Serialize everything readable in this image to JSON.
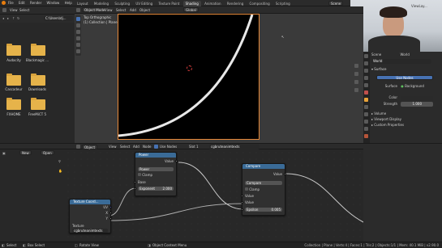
{
  "top_menu": [
    "File",
    "Edit",
    "Render",
    "Window",
    "Help"
  ],
  "workspace_tabs": [
    "Layout",
    "Modeling",
    "Sculpting",
    "UV Editing",
    "Texture Paint",
    "Shading",
    "Animation",
    "Rendering",
    "Compositing",
    "Scripting"
  ],
  "active_tab_index": 5,
  "scene": {
    "label": "Scene",
    "view_layer": "ViewLay..."
  },
  "file_browser": {
    "header_menu": [
      "View",
      "Select"
    ],
    "path": "C:\\Users\\dj...",
    "folders": [
      "Audacity",
      "Blackmagic ...",
      "Cascadeur",
      "Downloads",
      "FXHOME",
      "FreeMiCT 5"
    ]
  },
  "viewport": {
    "mode": "Object Mode",
    "menu": [
      "View",
      "Select",
      "Add",
      "Object"
    ],
    "shading": "Global",
    "view_name": "Top Orthographic",
    "collection": "(1) Collection | Plane"
  },
  "node_editor": {
    "object_mode": "Object",
    "menu": [
      "View",
      "Select",
      "Add",
      "Node"
    ],
    "use_nodes_label": "Use Nodes",
    "slot": "Slot 1",
    "material": "cgbruteanimtexts",
    "sidebar": {
      "new_label": "New",
      "open_label": "Open"
    }
  },
  "nodes": {
    "texcoord": {
      "title": "Texture Coord...",
      "outputs": [
        "UV",
        "X",
        "Y"
      ],
      "image_label": "Texture",
      "image_value": "cgbruteanimtexts"
    },
    "power": {
      "title": "Power",
      "output": "Value",
      "operation": "Power",
      "clamp": "Clamp",
      "base": "Base",
      "exponent_label": "Exponent",
      "exponent_value": "2.000"
    },
    "compare": {
      "title": "Compare",
      "output": "Value",
      "operation": "Compare",
      "clamp": "Clamp",
      "value1": "Value",
      "value2": "Value",
      "epsilon_label": "Epsilon",
      "epsilon_value": "0.005"
    }
  },
  "properties": {
    "scene_label": "Scene",
    "world_label": "World",
    "world_name": "World",
    "surface_label": "Surface",
    "use_nodes_label": "Use Nodes",
    "surface_field_label": "Surface",
    "surface_value": "Background",
    "color_label": "Color",
    "strength_label": "Strength",
    "strength_value": "1.000",
    "sections": [
      "Volume",
      "Viewport Display",
      "Custom Properties"
    ]
  },
  "status_bar": {
    "select": "Select",
    "box_select": "Box Select",
    "rotate_view": "Rotate View",
    "context_menu": "Object Context Menu",
    "stats": "Collection | Plane | Verts:4 | Faces:1 | Tris:2 | Objects:1/1 | Mem: 40.1 MiB | v2.90.0"
  },
  "colors": {
    "accent": "#4772b3",
    "node_header": "#3a6b97",
    "folder": "#e6b34a",
    "viewport_bg": "#000000",
    "curve": "#e8e8e8"
  }
}
